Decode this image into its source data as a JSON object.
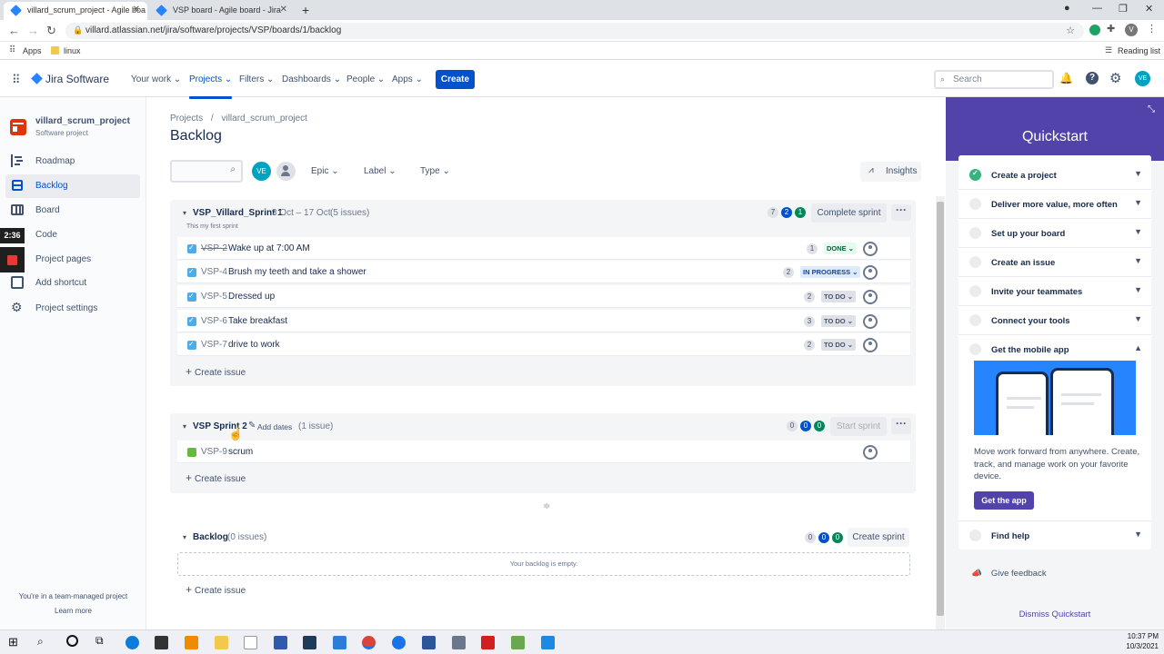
{
  "browser": {
    "tabs": [
      {
        "title": "villard_scrum_project - Agile boa",
        "active": true
      },
      {
        "title": "VSP board - Agile board - Jira",
        "active": false
      }
    ],
    "url": "villard.atlassian.net/jira/software/projects/VSP/boards/1/backlog",
    "bookmarks": {
      "apps": "Apps",
      "linux": "linux",
      "reading_list": "Reading list"
    }
  },
  "jira_nav": {
    "product": "Jira Software",
    "items": [
      "Your work",
      "Projects",
      "Filters",
      "Dashboards",
      "People",
      "Apps"
    ],
    "active": "Projects",
    "create": "Create",
    "search_placeholder": "Search",
    "user_initials": "VE"
  },
  "sidebar": {
    "project_name": "villard_scrum_project",
    "project_type": "Software project",
    "items": [
      "Roadmap",
      "Backlog",
      "Board",
      "Code",
      "Project pages",
      "Add shortcut",
      "Project settings"
    ],
    "active": "Backlog",
    "timer": "2:36",
    "footer_text": "You're in a team-managed project",
    "learn_more": "Learn more"
  },
  "main": {
    "breadcrumb": [
      "Projects",
      "villard_scrum_project"
    ],
    "title": "Backlog",
    "filters": {
      "avatar": "VE",
      "epic": "Epic",
      "label": "Label",
      "type": "Type",
      "insights": "Insights"
    },
    "sprint1": {
      "name": "VSP_Villard_Sprint 1",
      "dates": "3 Oct – 17 Oct",
      "count": "(5 issues)",
      "goal": "This my first sprint",
      "counts": [
        "7",
        "2",
        "1"
      ],
      "action": "Complete sprint",
      "issues": [
        {
          "key": "VSP-2",
          "summary": "Wake up at 7:00 AM",
          "points": "1",
          "status": "DONE"
        },
        {
          "key": "VSP-4",
          "summary": "Brush my teeth and take a shower",
          "points": "2",
          "status": "IN PROGRESS"
        },
        {
          "key": "VSP-5",
          "summary": "Dressed up",
          "points": "2",
          "status": "TO DO"
        },
        {
          "key": "VSP-6",
          "summary": "Take breakfast",
          "points": "3",
          "status": "TO DO"
        },
        {
          "key": "VSP-7",
          "summary": "drive to work",
          "points": "2",
          "status": "TO DO"
        }
      ],
      "create_issue": "Create issue"
    },
    "sprint2": {
      "name": "VSP Sprint 2",
      "add_dates": "Add dates",
      "count": "(1 issue)",
      "counts": [
        "0",
        "0",
        "0"
      ],
      "action": "Start sprint",
      "issues": [
        {
          "key": "VSP-9",
          "summary": "scrum"
        }
      ],
      "create_issue": "Create issue"
    },
    "backlog": {
      "name": "Backlog",
      "count": "(0 issues)",
      "counts": [
        "0",
        "0",
        "0"
      ],
      "action": "Create sprint",
      "empty": "Your backlog is empty.",
      "create_issue": "Create issue"
    }
  },
  "quickstart": {
    "title": "Quickstart",
    "items": [
      {
        "label": "Create a project",
        "done": true
      },
      {
        "label": "Deliver more value, more often",
        "done": false
      },
      {
        "label": "Set up your board",
        "done": false
      },
      {
        "label": "Create an issue",
        "done": false
      },
      {
        "label": "Invite your teammates",
        "done": false
      },
      {
        "label": "Connect your tools",
        "done": false
      },
      {
        "label": "Get the mobile app",
        "done": false
      }
    ],
    "mobile_text": "Move work forward from anywhere. Create, track, and manage work on your favorite device.",
    "get_app": "Get the app",
    "find_help": "Find help",
    "give_feedback": "Give feedback",
    "dismiss": "Dismiss Quickstart"
  },
  "taskbar": {
    "time": "10:37 PM",
    "date": "10/3/2021"
  },
  "colors": {
    "brand_blue": "#0052cc",
    "quickstart_purple": "#5243aa",
    "done_green": "#36b37e"
  }
}
